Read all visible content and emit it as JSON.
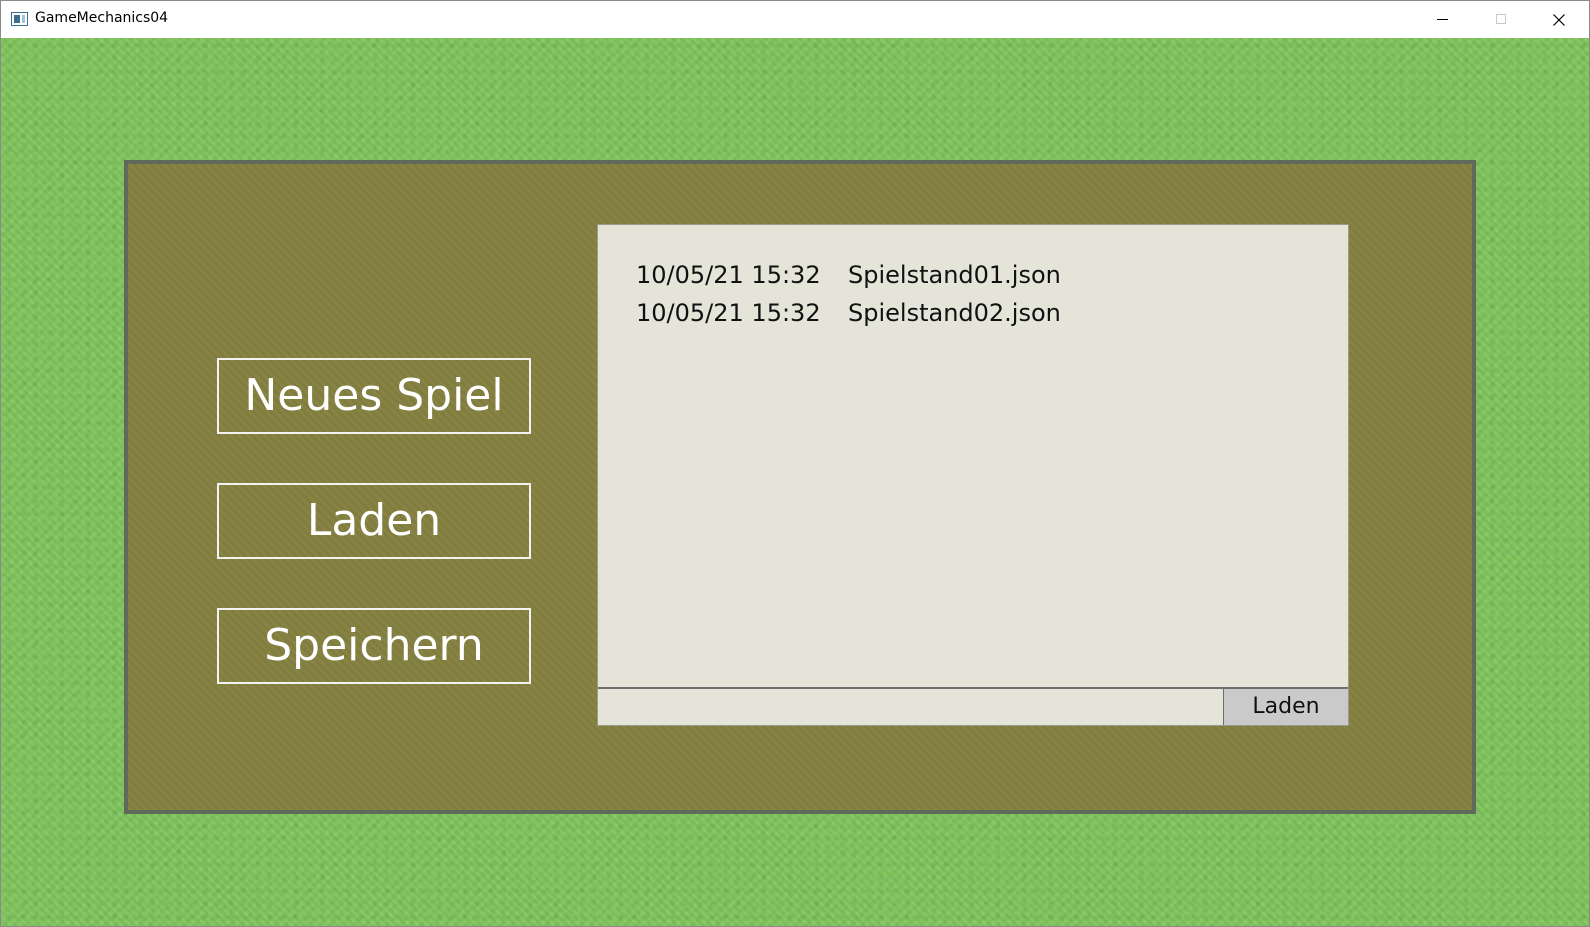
{
  "window": {
    "title": "GameMechanics04",
    "icons": {
      "app": "app-window-icon",
      "minimize": "minimize-icon",
      "maximize": "maximize-icon",
      "close": "close-icon"
    }
  },
  "menu": {
    "new_game": "Neues Spiel",
    "load": "Laden",
    "save": "Speichern"
  },
  "save_list": {
    "entries": [
      {
        "date": "10/05/21 15:32",
        "file": "Spielstand01.json"
      },
      {
        "date": "10/05/21 15:32",
        "file": "Spielstand02.json"
      }
    ],
    "filename_value": "",
    "load_button": "Laden"
  },
  "colors": {
    "background_grass": "#7ec45a",
    "panel": "#848040",
    "panel_border": "#5f6a5a",
    "list_background": "#e4e4d8",
    "load_button": "#cacaca"
  }
}
